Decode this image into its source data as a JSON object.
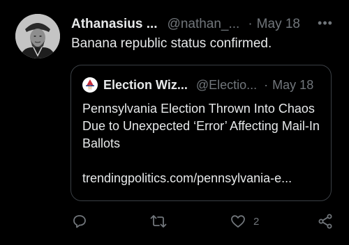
{
  "tweet": {
    "display_name": "Athanasius ...",
    "handle": "@nathan_...",
    "separator": "·",
    "date": "May 18",
    "more": "•••",
    "text": "Banana republic status confirmed.",
    "avatar": "engraved-portrait-avatar"
  },
  "quote": {
    "display_name": "Election Wiz...",
    "handle": "@Electio...",
    "separator": "·",
    "date": "May 18",
    "avatar": "wizard-avatar",
    "body": "Pennsylvania Election Thrown Into Chaos Due to Unexpected ‘Error’ Affecting Mail-In Ballots",
    "link": "trendingpolitics.com/pennsylvania-e..."
  },
  "actions": {
    "reply_icon": "reply-icon",
    "retweet_icon": "retweet-icon",
    "like_icon": "heart-icon",
    "like_count": "2",
    "share_icon": "share-icon"
  },
  "colors": {
    "background": "#000000",
    "primary_text": "#e7e9ea",
    "secondary_text": "#71767b",
    "border": "#3a3f44"
  }
}
